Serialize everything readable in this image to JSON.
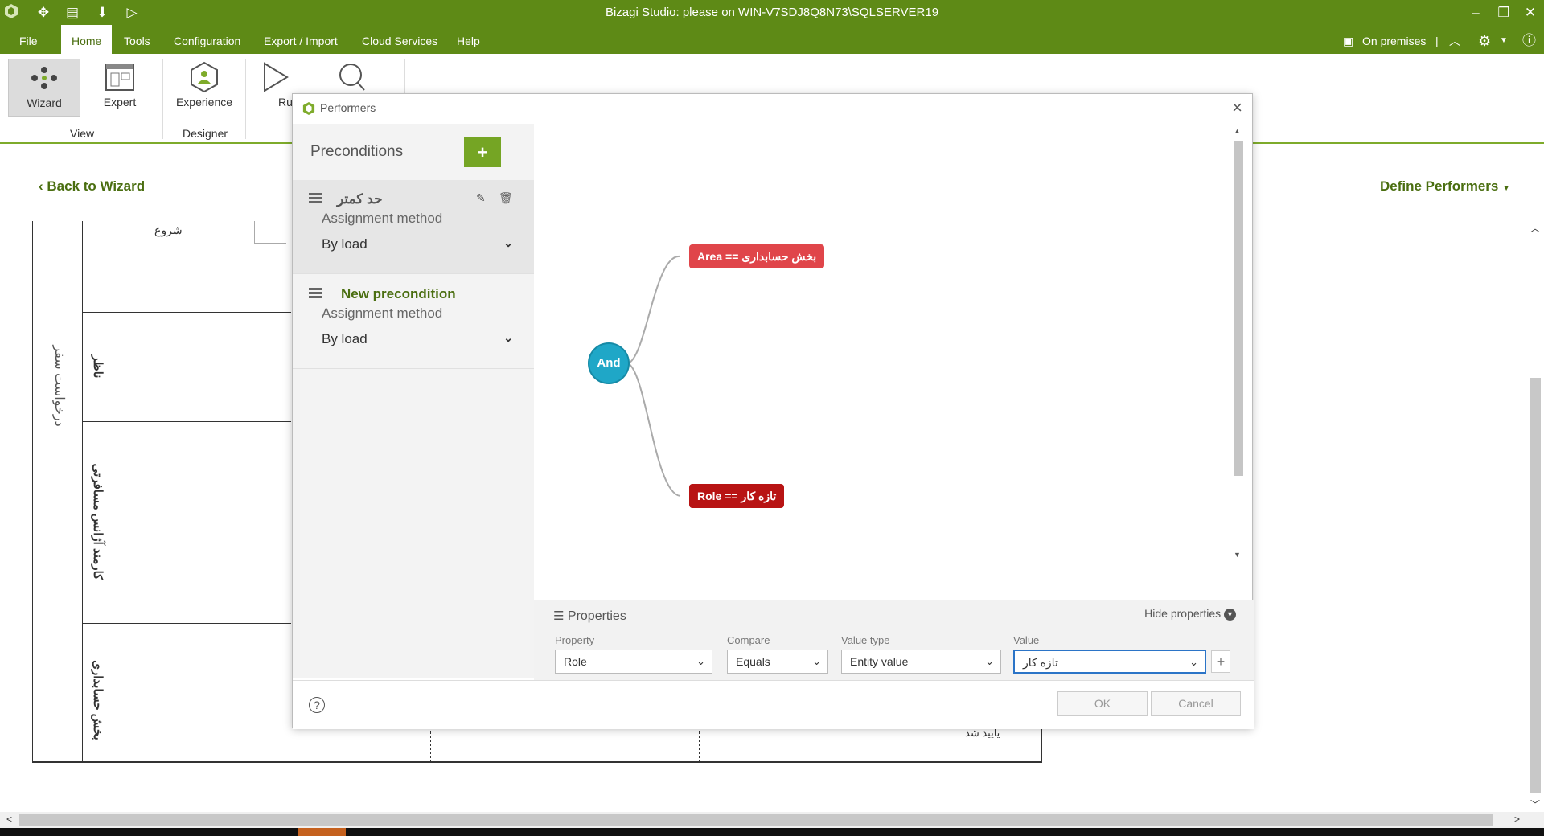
{
  "titlebar": {
    "title": "Bizagi Studio: please  on WIN-V7SDJ8Q8N73\\SQLSERVER19",
    "minimize": "–",
    "restore": "❐",
    "close": "✕"
  },
  "menubar": {
    "items": [
      "File",
      "Home",
      "Tools",
      "Configuration",
      "Export / Import",
      "Cloud Services",
      "Help"
    ],
    "active": "Home",
    "on_premises": "On premises"
  },
  "ribbon": {
    "wizard": "Wizard",
    "expert": "Expert",
    "experience": "Experience",
    "run": "Ru",
    "group_view": "View",
    "group_designer": "Designer"
  },
  "subheader": {
    "back": "Back to Wizard",
    "define": "Define Performers"
  },
  "diagram": {
    "pool_name": "درخواست سفر",
    "start_label": "شروع",
    "lanes": [
      "ناظر",
      "كارمند آژانس مسافرتى",
      "بخش حسابدارى"
    ],
    "bottom_text": "ياييد شد"
  },
  "modal": {
    "title": "Performers",
    "preconditions_label": "Preconditions",
    "add_label": "+",
    "preconditions": [
      {
        "name": "حد كمتر",
        "method_label": "Assignment method",
        "method_value": "By load",
        "selected": true
      },
      {
        "name": "New precondition",
        "method_label": "Assignment method",
        "method_value": "By load",
        "selected": false
      }
    ],
    "tree": {
      "root": "And",
      "conditions": [
        {
          "text": "Area == بخش حسابدارى",
          "color": "#e0454a"
        },
        {
          "text": "Role == تازه كار",
          "color": "#b81414"
        }
      ]
    },
    "properties": {
      "title": "Properties",
      "hide": "Hide properties",
      "property_label": "Property",
      "property_value": "Role",
      "compare_label": "Compare",
      "compare_value": "Equals",
      "value_type_label": "Value type",
      "value_type_value": "Entity value",
      "value_label": "Value",
      "value_value": "تازه كار"
    },
    "ok": "OK",
    "cancel": "Cancel"
  },
  "colors": {
    "brand_green": "#5e8a16",
    "accent_green": "#75a524",
    "and_node": "#1fa7c7"
  }
}
